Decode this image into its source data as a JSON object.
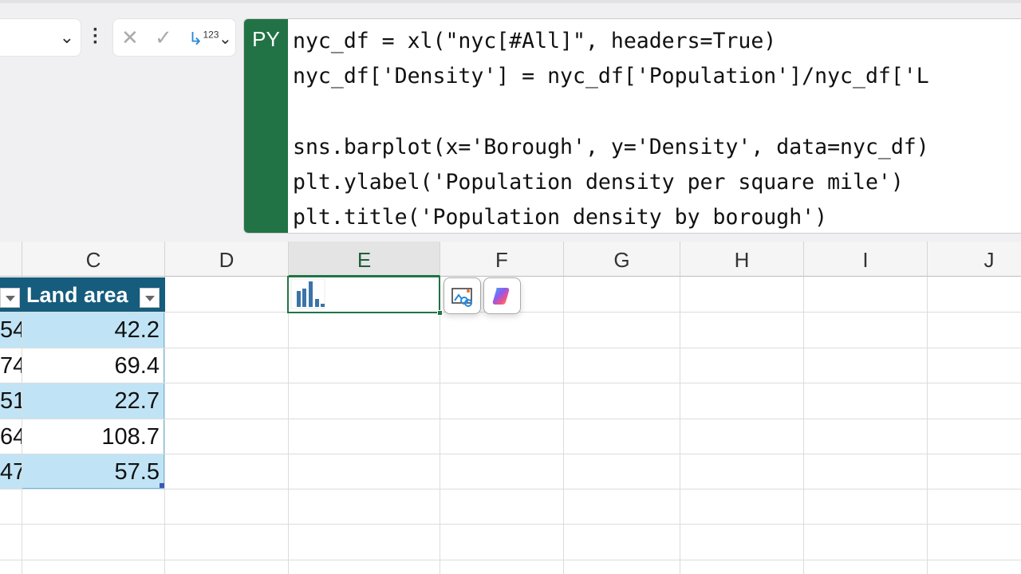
{
  "name_box": {
    "value": ""
  },
  "formula_bar": {
    "py_badge": "PY",
    "cancel_icon": "x-icon",
    "enter_icon": "check-icon",
    "python_output": "123",
    "code_lines": [
      "nyc_df = xl(\"nyc[#All]\", headers=True)",
      "nyc_df['Density'] = nyc_df['Population']/nyc_df['L",
      "",
      "sns.barplot(x='Borough', y='Density', data=nyc_df)",
      "plt.ylabel('Population density per square mile')",
      "plt.title('Population density by borough')"
    ]
  },
  "columns": [
    "C",
    "D",
    "E",
    "F",
    "G",
    "H",
    "I",
    "J"
  ],
  "table": {
    "header": "Land area",
    "partial_col": [
      "54",
      "74",
      "51",
      "64",
      "47"
    ],
    "land_area": [
      "42.2",
      "69.4",
      "22.7",
      "108.7",
      "57.5"
    ]
  },
  "selected_cell": {
    "column": "E",
    "content": "bar-chart-image"
  },
  "buttons": {
    "image_icon": "picture-link-icon",
    "copilot_icon": "copilot-icon"
  }
}
